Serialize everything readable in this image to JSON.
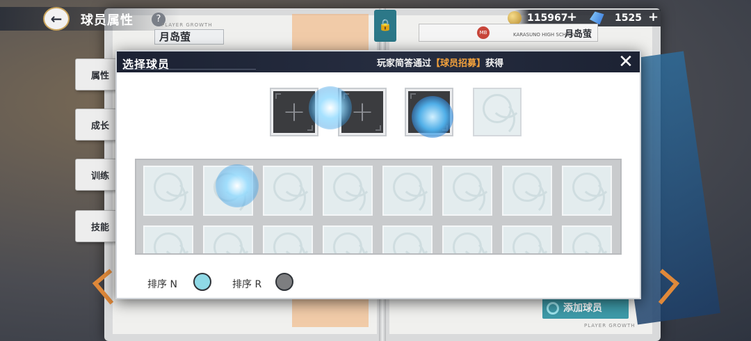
{
  "header": {
    "title": "球员属性",
    "help": "?",
    "player_name": "月岛萤",
    "back_icon": "arrow-left-icon"
  },
  "currency": {
    "coins": "115967",
    "gems": "1525",
    "plus": "+"
  },
  "player_card": {
    "name": "月岛萤",
    "school": "KARASUNO HIGH SCHOOL",
    "badge": "MB"
  },
  "side_tabs": [
    "属性",
    "成长",
    "训练",
    "技能"
  ],
  "labels": {
    "player_growth": "PLAYER GROWTH",
    "add_player": "添加球员"
  },
  "dialog": {
    "title": "选择球员",
    "notice_prefix": "玩家简答通过",
    "notice_highlight": "【球员招募】",
    "notice_suffix": "获得",
    "close_label": "✕",
    "sort": [
      {
        "label": "排序 N",
        "color": "#8fd9e6"
      },
      {
        "label": "排序 R",
        "color": "#7d7e80"
      }
    ]
  },
  "colors": {
    "accent_orange": "#f3a13c",
    "header_dark": "#1c2233",
    "add_button": "#3d9aa8"
  }
}
